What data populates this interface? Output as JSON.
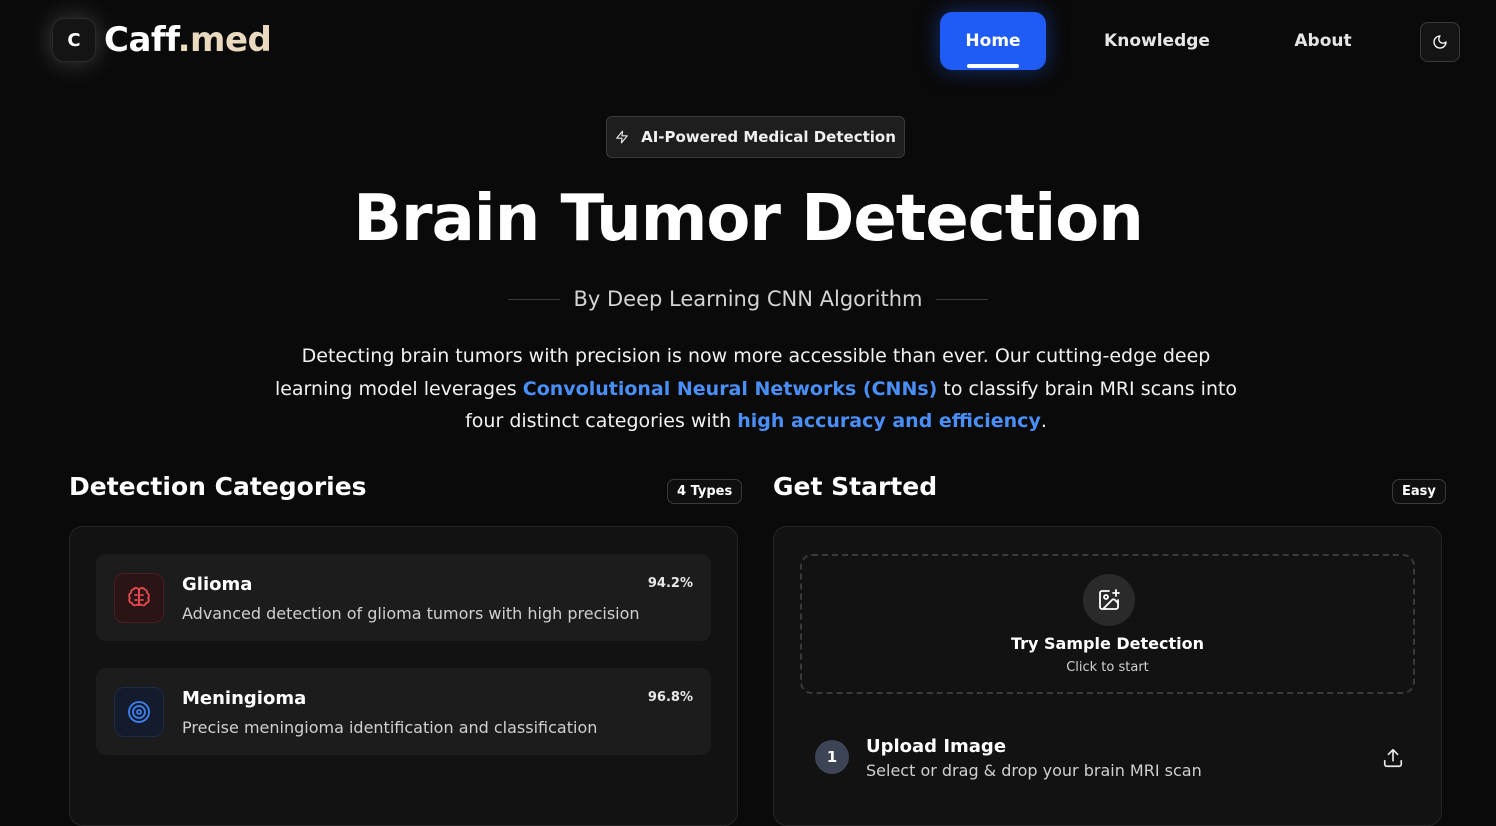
{
  "nav": {
    "logo_badge": "C",
    "logo_text_a": "Caff",
    "logo_text_b": ".med",
    "items": [
      {
        "label": "Home",
        "active": true
      },
      {
        "label": "Knowledge",
        "active": false
      },
      {
        "label": "About",
        "active": false
      }
    ],
    "theme_icon": "moon-icon"
  },
  "hero": {
    "badge": "AI-Powered Medical Detection",
    "badge_icon": "lightning-icon",
    "title": "Brain Tumor Detection",
    "subtitle": "By Deep Learning CNN Algorithm",
    "desc_1": "Detecting brain tumors with precision is now more accessible than ever. Our cutting-edge deep learning model leverages ",
    "desc_hl_1": "Convolutional Neural Networks (CNNs)",
    "desc_2": " to classify brain MRI scans into four distinct categories with ",
    "desc_hl_2": "high accuracy and efficiency",
    "desc_3": "."
  },
  "categories": {
    "title": "Detection Categories",
    "tag": "4 Types",
    "items": [
      {
        "name": "Glioma",
        "desc": "Advanced detection of glioma tumors with high precision",
        "accuracy": "94.2%",
        "icon": "brain-icon",
        "color": "#e5484d"
      },
      {
        "name": "Meningioma",
        "desc": "Precise meningioma identification and classification",
        "accuracy": "96.8%",
        "icon": "target-icon",
        "color": "#3b82f6"
      }
    ]
  },
  "get_started": {
    "title": "Get Started",
    "tag": "Easy",
    "sample_title": "Try Sample Detection",
    "sample_sub": "Click to start",
    "sample_icon": "image-plus-icon",
    "step": {
      "number": "1",
      "title": "Upload Image",
      "desc": "Select or drag & drop your brain MRI scan",
      "icon": "upload-icon"
    }
  },
  "colors": {
    "accent": "#1f5cf5",
    "highlight": "#4a8ff7",
    "background": "#0a0a0a"
  }
}
